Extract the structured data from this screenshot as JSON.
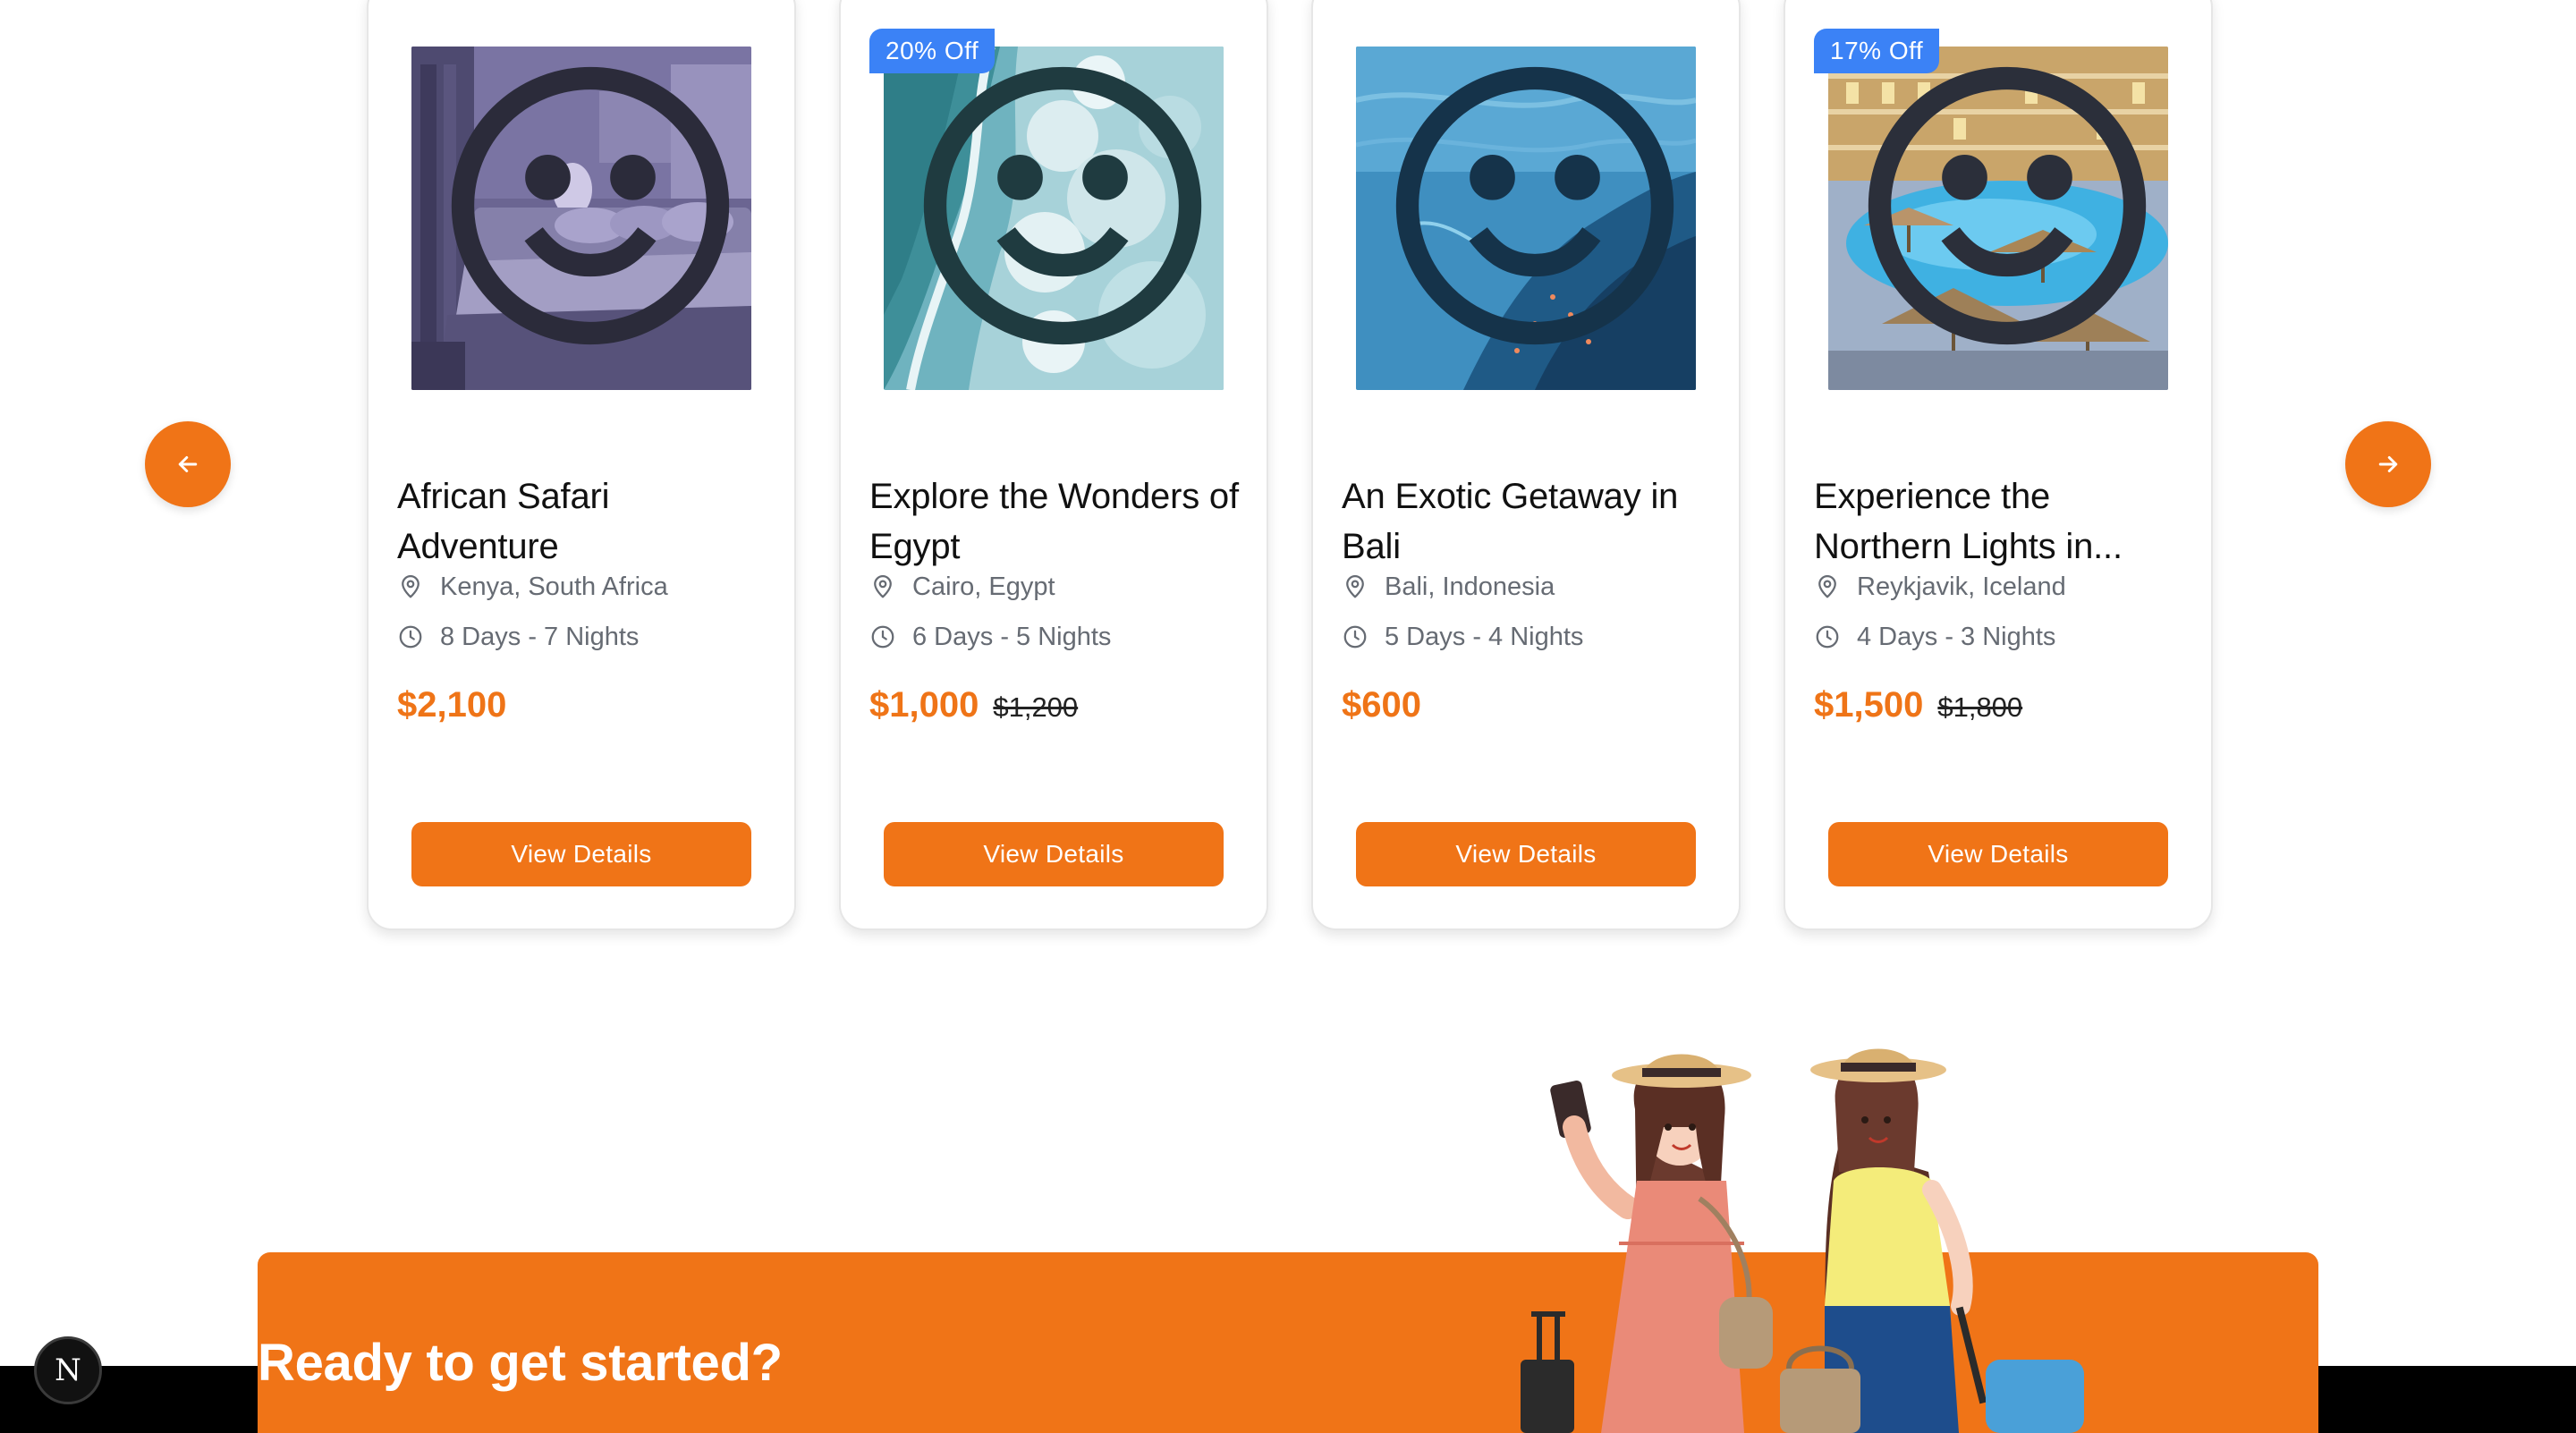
{
  "carousel": {
    "prev_icon": "arrow-left-icon",
    "next_icon": "arrow-right-icon",
    "cards": [
      {
        "title": "African Safari Adventure",
        "location": "Kenya, South Africa",
        "duration": "8 Days - 7 Nights",
        "price": "$2,100",
        "old_price": "",
        "badge": "",
        "button": "View Details",
        "image": "hotel-bedroom"
      },
      {
        "title": "Explore the Wonders of Egypt",
        "location": "Cairo, Egypt",
        "duration": "6 Days - 5 Nights",
        "price": "$1,000",
        "old_price": "$1,200",
        "badge": "20% Off",
        "button": "View Details",
        "image": "ocean-waves-aerial"
      },
      {
        "title": "An Exotic Getaway in Bali",
        "location": "Bali, Indonesia",
        "duration": "5 Days - 4 Nights",
        "price": "$600",
        "old_price": "",
        "badge": "",
        "button": "View Details",
        "image": "underwater-reef"
      },
      {
        "title": "Experience the Northern Lights in...",
        "location": "Reykjavik, Iceland",
        "duration": "4 Days - 3 Nights",
        "price": "$1,500",
        "old_price": "$1,800",
        "badge": "17% Off",
        "button": "View Details",
        "image": "resort-pool"
      }
    ]
  },
  "cta": {
    "title": "Ready to get started?",
    "subtitle": "",
    "illustration": "two-travelers-illustration"
  },
  "colors": {
    "accent": "#f07417",
    "badge": "#3b82f6",
    "muted_text": "#666b73"
  },
  "devtools": {
    "letter": "N"
  }
}
